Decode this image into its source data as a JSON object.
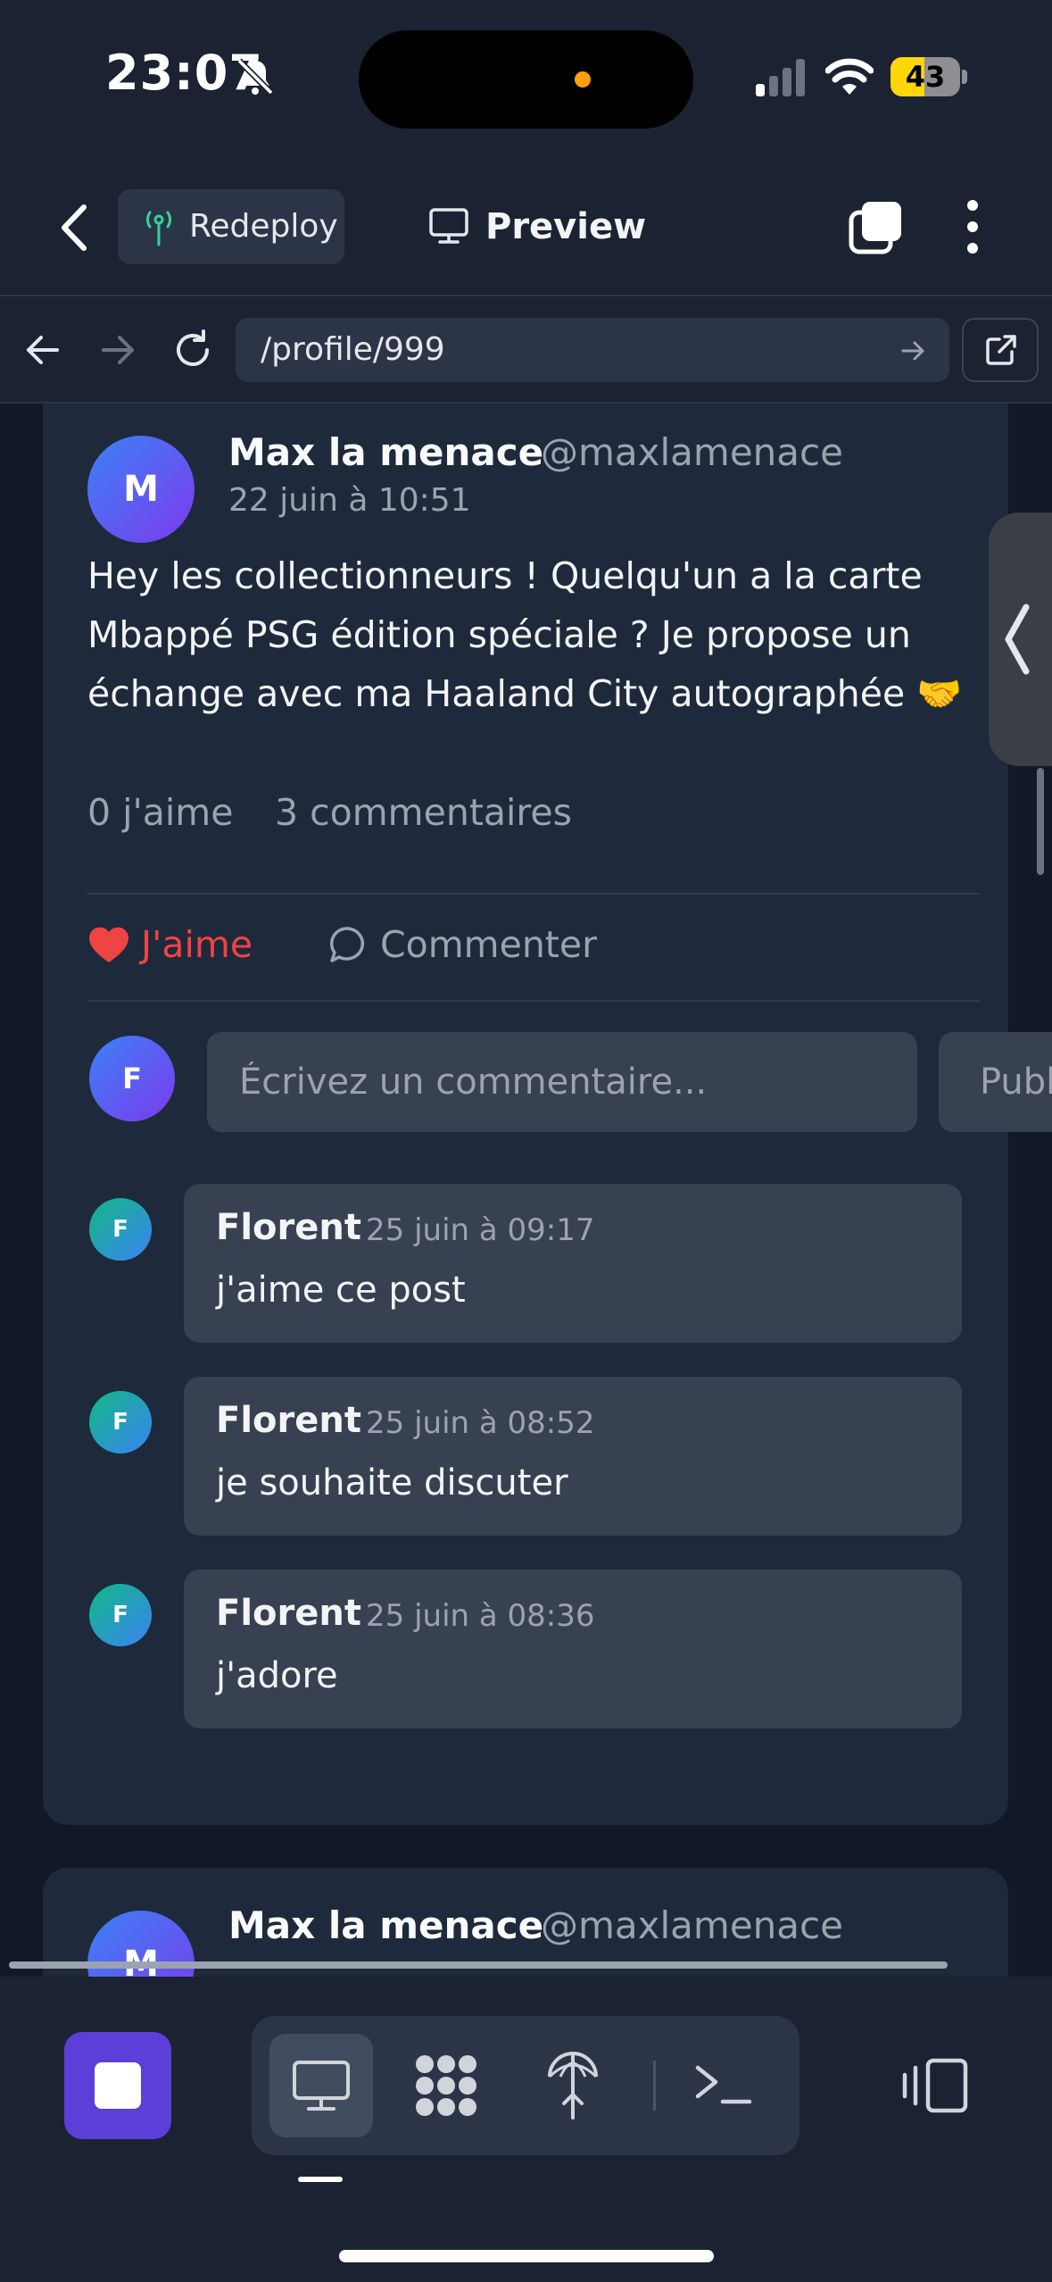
{
  "status_bar": {
    "time": "23:07",
    "battery_level": "43",
    "battery_color": "#ffd60a",
    "icons": [
      "bell-off-icon",
      "signal-icon",
      "wifi-icon",
      "battery-icon"
    ]
  },
  "app_bar": {
    "redeploy_label": "Redeploy",
    "preview_label": "Preview",
    "icons": [
      "chevron-left-icon",
      "antenna-icon",
      "monitor-icon",
      "tabs-icon",
      "more-vertical-icon"
    ]
  },
  "browser": {
    "url": "/profile/999",
    "icons": [
      "arrow-left-icon",
      "arrow-right-icon",
      "reload-icon",
      "arrow-right-small-icon",
      "external-link-icon"
    ]
  },
  "post": {
    "avatar_initial": "M",
    "author_name": "Max la menace",
    "author_handle": "@maxlamenace",
    "date": "22 juin à 10:51",
    "text": "Hey les collectionneurs ! Quelqu'un a la carte Mbappé PSG édition spéciale ? Je propose un échange avec ma Haaland City autographée 🤝",
    "likes_count": "0 j'aime",
    "comments_count": "3 commentaires",
    "like_label": "J'aime",
    "comment_label": "Commenter",
    "like_color": "#ef4444"
  },
  "composer": {
    "avatar_initial": "F",
    "placeholder": "Écrivez un commentaire...",
    "publish_label": "Publier"
  },
  "comments": [
    {
      "initial": "F",
      "author": "Florent",
      "date": "25 juin à 09:17",
      "text": "j'aime ce post"
    },
    {
      "initial": "F",
      "author": "Florent",
      "date": "25 juin à 08:52",
      "text": "je souhaite discuter"
    },
    {
      "initial": "F",
      "author": "Florent",
      "date": "25 juin à 08:36",
      "text": "j'adore"
    }
  ],
  "next_post": {
    "avatar_initial": "M",
    "author_name": "Max la menace",
    "author_handle": "@maxlamenace"
  },
  "toolbar": {
    "accent_color": "#5b3fd8",
    "icons": [
      "stop-icon",
      "monitor-icon",
      "apps-grid-icon",
      "deploy-antenna-icon",
      "terminal-icon",
      "side-panel-icon"
    ]
  }
}
